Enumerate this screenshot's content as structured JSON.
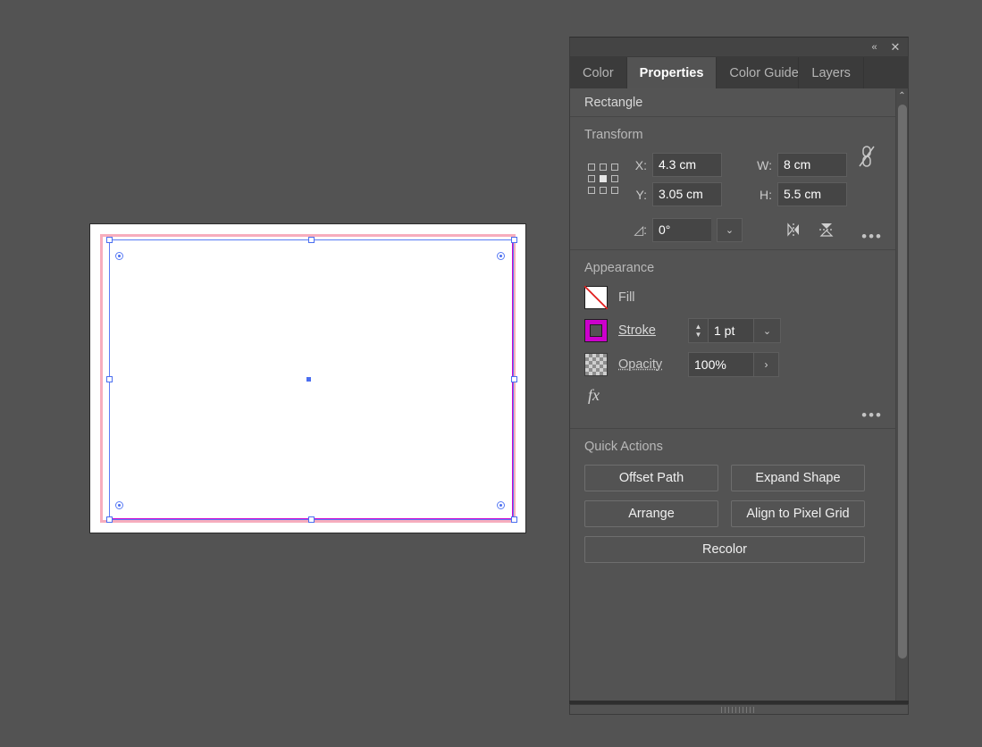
{
  "app": {
    "panel_titlebar": {
      "collapse_label": "«",
      "close_label": "✕"
    },
    "tabs": [
      {
        "label": "Color",
        "active": false
      },
      {
        "label": "Properties",
        "active": true
      },
      {
        "label": "Color Guide",
        "active": false
      },
      {
        "label": "Layers",
        "active": false
      }
    ],
    "object_header": "Rectangle",
    "scroll_up_glyph": "⌃"
  },
  "transform": {
    "title": "Transform",
    "reference_point": "center",
    "x_label": "X:",
    "x_value": "4.3 cm",
    "y_label": "Y:",
    "y_value": "3.05 cm",
    "w_label": "W:",
    "w_value": "8 cm",
    "h_label": "H:",
    "h_value": "5.5 cm",
    "angle_label": "◿:",
    "angle_value": "0°",
    "angle_dropdown_glyph": "⌄",
    "link_icon_name": "constrain-proportions-off",
    "flip_horizontal_label": "Flip Horizontal",
    "flip_vertical_label": "Flip Vertical",
    "more_options": "•••"
  },
  "appearance": {
    "title": "Appearance",
    "fill": {
      "label": "Fill",
      "value": "None"
    },
    "stroke": {
      "label": "Stroke",
      "color": "#cc00cc",
      "width": "1 pt",
      "dropdown_glyph": "⌄",
      "up_glyph": "▲",
      "down_glyph": "▼"
    },
    "opacity": {
      "label": "Opacity",
      "value": "100%",
      "arrow_glyph": "›"
    },
    "fx_label": "fx",
    "more_options": "•••"
  },
  "quick_actions": {
    "title": "Quick Actions",
    "buttons": [
      {
        "label": "Offset Path",
        "span": "half"
      },
      {
        "label": "Expand Shape",
        "span": "half"
      },
      {
        "label": "Arrange",
        "span": "half"
      },
      {
        "label": "Align to Pixel Grid",
        "span": "half"
      },
      {
        "label": "Recolor",
        "span": "full"
      }
    ]
  },
  "canvas": {
    "artboard_background": "#ffffff",
    "bleed_guide_color": "#f7adbd",
    "shape_stroke_color": "#cc00cc",
    "selection_color": "#5a7cf5",
    "workspace_background": "#535353"
  }
}
